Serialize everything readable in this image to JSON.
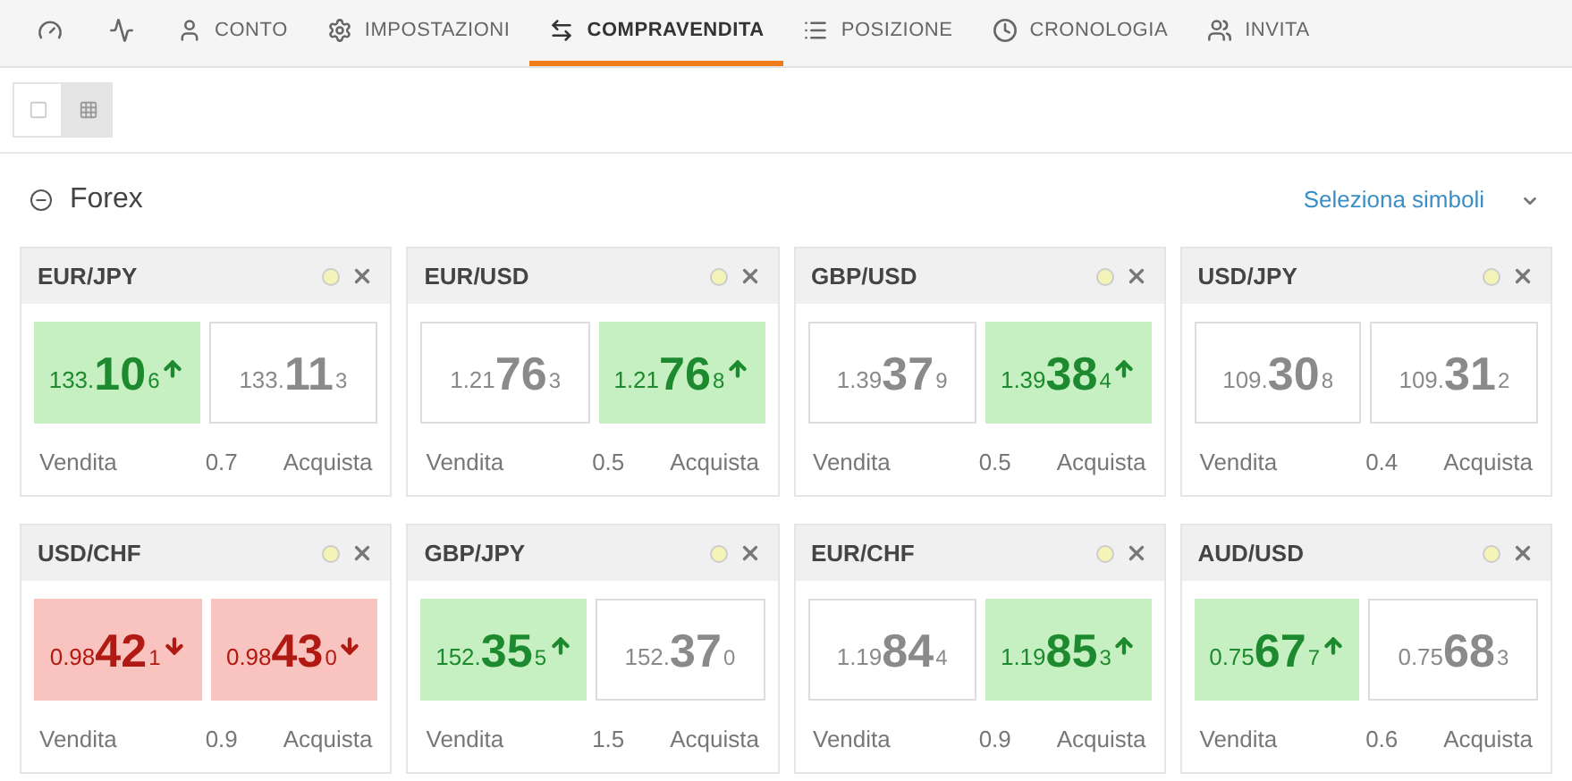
{
  "nav": [
    {
      "kind": "gauge",
      "selected": false
    },
    {
      "kind": "chart",
      "selected": false
    },
    {
      "kind": "user",
      "label": "CONTO",
      "selected": false
    },
    {
      "kind": "gear",
      "label": "IMPOSTAZIONI",
      "selected": false
    },
    {
      "kind": "swap",
      "label": "COMPRAVENDITA",
      "selected": true
    },
    {
      "kind": "list",
      "label": "POSIZIONE",
      "selected": false
    },
    {
      "kind": "clock",
      "label": "CRONOLOGIA",
      "selected": false
    },
    {
      "kind": "invite",
      "label": "INVITA",
      "selected": false
    }
  ],
  "view_toggle": [
    {
      "kind": "tiles",
      "selected": false
    },
    {
      "kind": "grid",
      "selected": true
    }
  ],
  "section": {
    "title": "Forex",
    "expanded": true,
    "select_link": "Seleziona simboli"
  },
  "cards": [
    {
      "symbol": "EUR/JPY",
      "sell": {
        "prefix": "133.",
        "big": "10",
        "small": "6",
        "kind": "up"
      },
      "buy": {
        "prefix": "133.",
        "big": "11",
        "small": "3",
        "kind": "flat"
      },
      "sell_label": "Vendita",
      "spread": "0.7",
      "buy_label": "Acquista"
    },
    {
      "symbol": "EUR/USD",
      "sell": {
        "prefix": "1.21",
        "big": "76",
        "small": "3",
        "kind": "flat"
      },
      "buy": {
        "prefix": "1.21",
        "big": "76",
        "small": "8",
        "kind": "up"
      },
      "sell_label": "Vendita",
      "spread": "0.5",
      "buy_label": "Acquista"
    },
    {
      "symbol": "GBP/USD",
      "sell": {
        "prefix": "1.39",
        "big": "37",
        "small": "9",
        "kind": "flat"
      },
      "buy": {
        "prefix": "1.39",
        "big": "38",
        "small": "4",
        "kind": "up"
      },
      "sell_label": "Vendita",
      "spread": "0.5",
      "buy_label": "Acquista"
    },
    {
      "symbol": "USD/JPY",
      "sell": {
        "prefix": "109.",
        "big": "30",
        "small": "8",
        "kind": "flat"
      },
      "buy": {
        "prefix": "109.",
        "big": "31",
        "small": "2",
        "kind": "flat"
      },
      "sell_label": "Vendita",
      "spread": "0.4",
      "buy_label": "Acquista"
    },
    {
      "symbol": "USD/CHF",
      "sell": {
        "prefix": "0.98",
        "big": "42",
        "small": "1",
        "kind": "down"
      },
      "buy": {
        "prefix": "0.98",
        "big": "43",
        "small": "0",
        "kind": "down"
      },
      "sell_label": "Vendita",
      "spread": "0.9",
      "buy_label": "Acquista"
    },
    {
      "symbol": "GBP/JPY",
      "sell": {
        "prefix": "152.",
        "big": "35",
        "small": "5",
        "kind": "up"
      },
      "buy": {
        "prefix": "152.",
        "big": "37",
        "small": "0",
        "kind": "flat"
      },
      "sell_label": "Vendita",
      "spread": "1.5",
      "buy_label": "Acquista"
    },
    {
      "symbol": "EUR/CHF",
      "sell": {
        "prefix": "1.19",
        "big": "84",
        "small": "4",
        "kind": "flat"
      },
      "buy": {
        "prefix": "1.19",
        "big": "85",
        "small": "3",
        "kind": "up"
      },
      "sell_label": "Vendita",
      "spread": "0.9",
      "buy_label": "Acquista"
    },
    {
      "symbol": "AUD/USD",
      "sell": {
        "prefix": "0.75",
        "big": "67",
        "small": "7",
        "kind": "up"
      },
      "buy": {
        "prefix": "0.75",
        "big": "68",
        "small": "3",
        "kind": "flat"
      },
      "sell_label": "Vendita",
      "spread": "0.6",
      "buy_label": "Acquista"
    }
  ]
}
